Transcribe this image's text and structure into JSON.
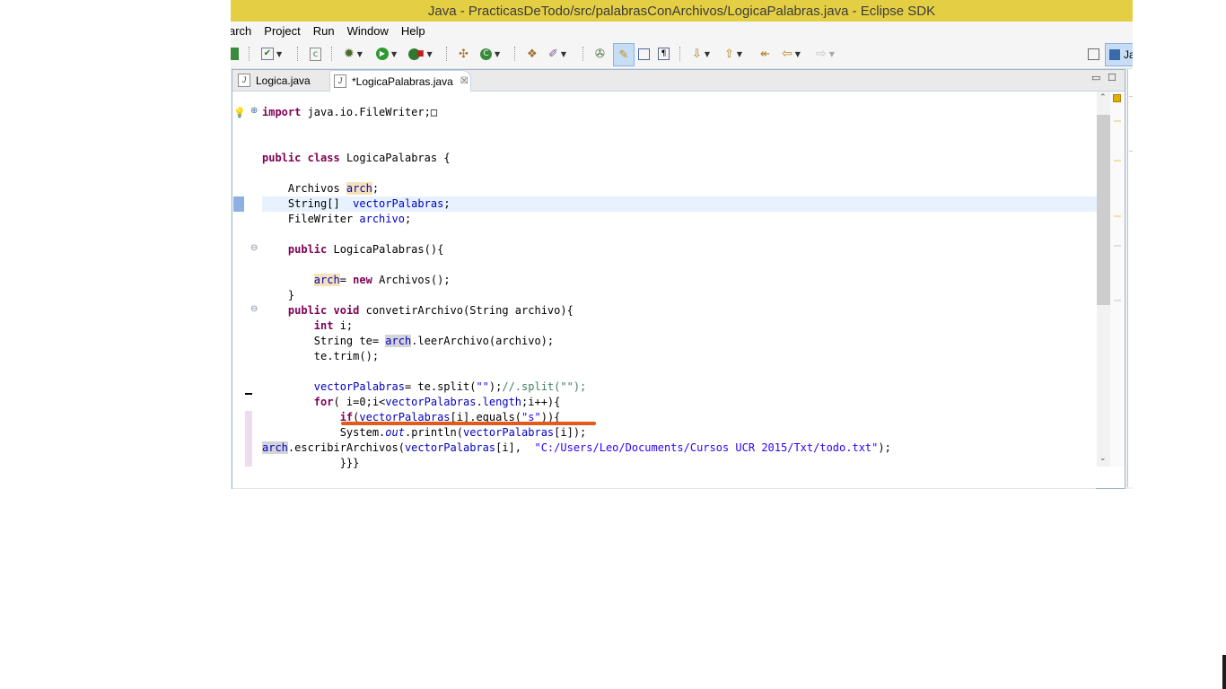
{
  "window": {
    "title": "Java - PracticasDeTodo/src/palabrasConArchivos/LogicaPalabras.java - Eclipse SDK"
  },
  "menu": [
    "arch",
    "Project",
    "Run",
    "Window",
    "Help"
  ],
  "perspective": {
    "label": "Ja"
  },
  "tabs": [
    {
      "label": "Logica.java",
      "icon": "java-file-icon",
      "active": false
    },
    {
      "label": "*LogicaPalabras.java",
      "icon": "java-file-icon",
      "active": true
    }
  ],
  "code": {
    "lines": [
      [
        {
          "t": "import",
          "c": "kw"
        },
        {
          "t": " java.io.FileWriter;"
        },
        {
          "t": "□"
        }
      ],
      [],
      [],
      [
        {
          "t": "public",
          "c": "kw"
        },
        {
          "t": " "
        },
        {
          "t": "class",
          "c": "kw"
        },
        {
          "t": " LogicaPalabras {"
        }
      ],
      [],
      [
        {
          "t": "    Archivos "
        },
        {
          "t": "arch",
          "c": "fld occ"
        },
        {
          "t": ";"
        }
      ],
      [
        {
          "t": "    String[]  "
        },
        {
          "t": "vectorPalabras",
          "c": "fld"
        },
        {
          "t": ";"
        }
      ],
      [
        {
          "t": "    FileWriter "
        },
        {
          "t": "archivo",
          "c": "fld"
        },
        {
          "t": ";"
        }
      ],
      [],
      [
        {
          "t": "    "
        },
        {
          "t": "public",
          "c": "kw"
        },
        {
          "t": " LogicaPalabras(){"
        }
      ],
      [],
      [
        {
          "t": "        "
        },
        {
          "t": "arch",
          "c": "fld occ"
        },
        {
          "t": "= "
        },
        {
          "t": "new",
          "c": "kw"
        },
        {
          "t": " Archivos();"
        }
      ],
      [
        {
          "t": "    }"
        }
      ],
      [
        {
          "t": "    "
        },
        {
          "t": "public",
          "c": "kw"
        },
        {
          "t": " "
        },
        {
          "t": "void",
          "c": "kw"
        },
        {
          "t": " convetirArchivo(String archivo){"
        }
      ],
      [
        {
          "t": "        "
        },
        {
          "t": "int",
          "c": "kw"
        },
        {
          "t": " i;"
        }
      ],
      [
        {
          "t": "        String te= "
        },
        {
          "t": "arch",
          "c": "fld occ2"
        },
        {
          "t": ".leerArchivo(archivo);"
        }
      ],
      [
        {
          "t": "        te.trim();"
        }
      ],
      [],
      [
        {
          "t": "        "
        },
        {
          "t": "vectorPalabras",
          "c": "fld"
        },
        {
          "t": "= te.split("
        },
        {
          "t": "\"\"",
          "c": "str"
        },
        {
          "t": ");"
        },
        {
          "t": "//.split(\"\");",
          "c": "cmt"
        }
      ],
      [
        {
          "t": "        "
        },
        {
          "t": "for",
          "c": "kw"
        },
        {
          "t": "( i=0;i<"
        },
        {
          "t": "vectorPalabras",
          "c": "fld"
        },
        {
          "t": "."
        },
        {
          "t": "length",
          "c": "fld"
        },
        {
          "t": ";i++){"
        }
      ],
      [
        {
          "t": "            "
        },
        {
          "t": "if",
          "c": "kw"
        },
        {
          "t": "("
        },
        {
          "t": "vectorPalabras",
          "c": "fld"
        },
        {
          "t": "[i].equals("
        },
        {
          "t": "\"s\"",
          "c": "str"
        },
        {
          "t": ")){"
        }
      ],
      [
        {
          "t": "            System."
        },
        {
          "t": "out",
          "c": "fld-i"
        },
        {
          "t": ".println("
        },
        {
          "t": "vectorPalabras",
          "c": "fld"
        },
        {
          "t": "[i]);"
        }
      ],
      [
        {
          "t": "arch",
          "c": "fld occ2"
        },
        {
          "t": ".escribirArchivos("
        },
        {
          "t": "vectorPalabras",
          "c": "fld"
        },
        {
          "t": "[i],  "
        },
        {
          "t": "\"C:/Users/Leo/Documents/Cursos UCR 2015/Txt/todo.txt\"",
          "c": "str"
        },
        {
          "t": ");"
        }
      ],
      [
        {
          "t": "            }}}"
        }
      ]
    ],
    "current_line": 6
  }
}
